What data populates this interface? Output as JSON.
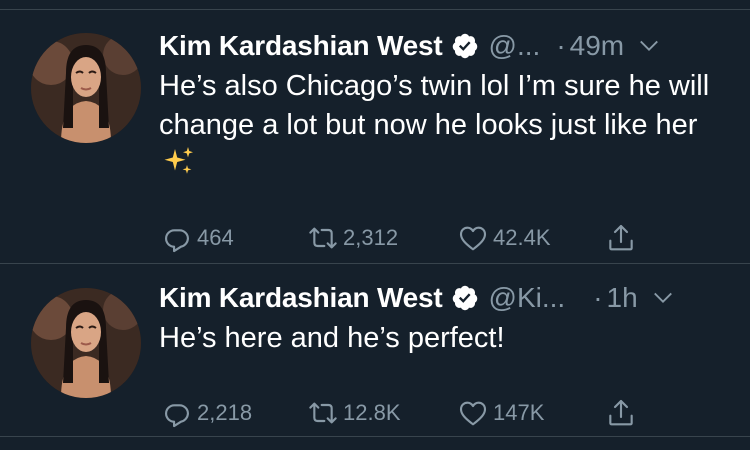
{
  "tweets": [
    {
      "name": "Kim Kardashian West",
      "handle": "@...",
      "dot": "·",
      "time": "49m",
      "text": "He’s also Chicago’s twin lol I’m sure he will change a lot but now he looks just like her",
      "emoji": "sparkles",
      "replies": "464",
      "retweets": "2,312",
      "likes": "42.4K"
    },
    {
      "name": "Kim Kardashian West",
      "handle": "@Ki...",
      "dot": "·",
      "time": "1h",
      "text": "He’s here and he’s perfect!",
      "replies": "2,218",
      "retweets": "12.8K",
      "likes": "147K"
    }
  ],
  "colors": {
    "background": "#15202b",
    "divider": "#38444d",
    "secondary_text": "#8899a6",
    "verified_badge": "#ffffff"
  },
  "icons": [
    "verified-badge-icon",
    "chevron-down-icon",
    "reply-icon",
    "retweet-icon",
    "like-icon",
    "share-icon",
    "sparkles-emoji"
  ]
}
